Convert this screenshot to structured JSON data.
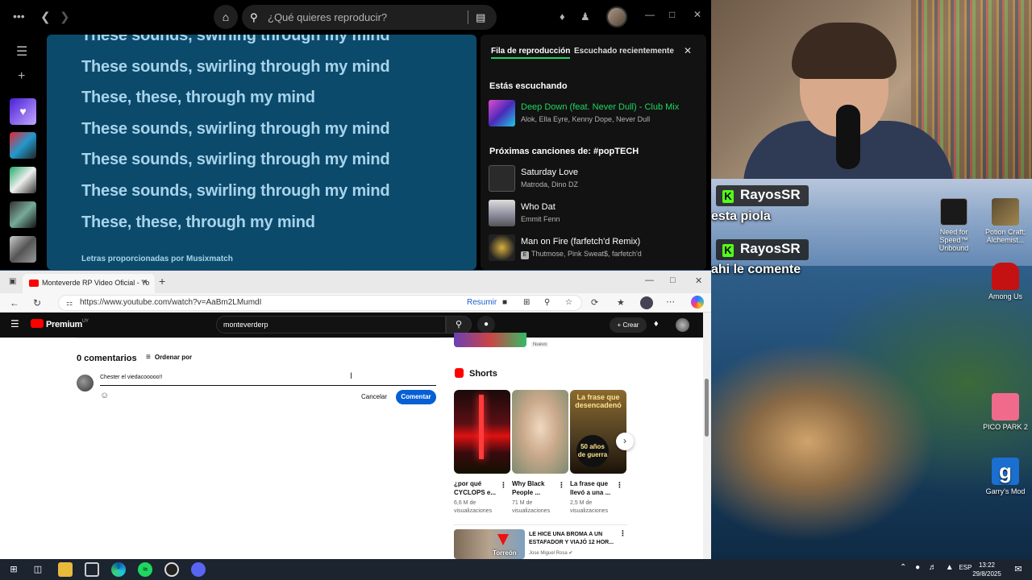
{
  "spotify": {
    "search_placeholder": "¿Qué quieres reproducir?",
    "lyrics": [
      "These sounds, swirling through my mind",
      "These sounds, swirling through my mind",
      "These, these, through my mind",
      "These sounds, swirling through my mind",
      "These sounds, swirling through my mind",
      "These sounds, swirling through my mind",
      "These, these, through my mind"
    ],
    "lyrics_credit": "Letras proporcionadas por Musixmatch",
    "queue": {
      "tab_queue": "Fila de reproducción",
      "tab_recent": "Escuchado recientemente",
      "now_playing_heading": "Estás escuchando",
      "now_playing": {
        "title": "Deep Down (feat. Never Dull) - Club Mix",
        "artists": "Alok, Ella Eyre, Kenny Dope, Never Dull"
      },
      "next_heading": "Próximas canciones de: #popTECH",
      "next": [
        {
          "title": "Saturday Love",
          "artists": "Matroda, Dino DZ",
          "explicit": false
        },
        {
          "title": "Who Dat",
          "artists": "Emmit Fenn",
          "explicit": false
        },
        {
          "title": "Man on Fire (farfetch'd Remix)",
          "artists": "Thutmose, Pink Sweat$, farfetch'd",
          "explicit": true,
          "explicit_label": "E"
        }
      ]
    },
    "accent": "#1ed760"
  },
  "edge": {
    "tab_title": "Monteverde RP Video Oficial - Yo",
    "url": "https://www.youtube.com/watch?v=AaBm2LMumdI",
    "resumir": "Resumir"
  },
  "youtube": {
    "logo_text": "Premium",
    "logo_superscript": "UY",
    "search_value": "monteverderp",
    "create_label": "+ Crear",
    "comments_title": "0 comentarios",
    "sort_label": "Ordenar por",
    "comment_text": "Chester el viedacooooo!!",
    "cancel_label": "Cancelar",
    "comment_label": "Comentar",
    "new_badge": "Nuevo",
    "shorts_heading": "Shorts",
    "shorts": [
      {
        "title": "¿por qué CYCLOPS e...",
        "views": "6,6 M de visualizaciones"
      },
      {
        "title": "Why Black People ...",
        "views": "71 M de visualizaciones"
      },
      {
        "title": "La frase que llevó a una ...",
        "views": "2,5 M de visualizaciones",
        "overlay_top": "La frase que desencadenó",
        "overlay_bottom": "50 años de guerra"
      }
    ],
    "recommended": {
      "title": "LE HICE UNA BROMA A UN ESTAFADOR Y VIAJÓ 12 HOR...",
      "channel": "Jose Miguel Rosa",
      "thumb_text": "Torreón"
    },
    "accent_blue": "#065fd4"
  },
  "chat": [
    {
      "user": "RayosSR",
      "message": "esta piola"
    },
    {
      "user": "RayosSR",
      "message": "ahi le comente"
    }
  ],
  "desktop_icons": [
    {
      "label": "Need for Speed™ Unbound"
    },
    {
      "label": "Potion Craft: Alchemist..."
    },
    {
      "label": "Among Us"
    },
    {
      "label": "PICO PARK 2"
    },
    {
      "label": "Garry's Mod"
    }
  ],
  "taskbar": {
    "lang": "ESP",
    "time": "13:22",
    "date": "29/8/2025"
  }
}
